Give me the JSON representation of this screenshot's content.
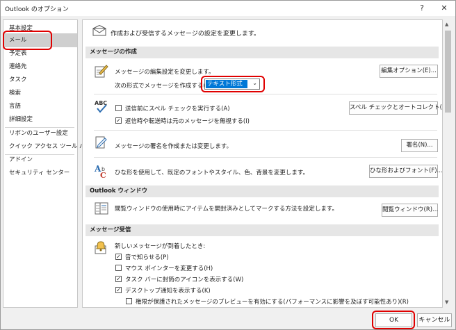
{
  "window": {
    "title": "Outlook のオプション",
    "help_label": "?",
    "close_label": "✕"
  },
  "sidebar": {
    "items": [
      {
        "label": "基本設定"
      },
      {
        "label": "メール"
      },
      {
        "label": "予定表"
      },
      {
        "label": "連絡先"
      },
      {
        "label": "タスク"
      },
      {
        "label": "検索"
      },
      {
        "label": "言語"
      },
      {
        "label": "詳細設定"
      },
      {
        "label": "リボンのユーザー設定"
      },
      {
        "label": "クイック アクセス ツール バー"
      },
      {
        "label": "アドイン"
      },
      {
        "label": "セキュリティ センター"
      }
    ],
    "selected": "メール"
  },
  "main": {
    "intro": "作成および受信するメッセージの設定を変更します。",
    "compose": {
      "header": "メッセージの作成",
      "edit_settings_text": "メッセージの編集設定を変更します。",
      "edit_options_button": "編集オプション(E)...",
      "format_label": "次の形式でメッセージを作成する(C):",
      "format_value": "テキスト形式",
      "spell_check_before_send": {
        "label": "送信前にスペル チェックを実行する(A)",
        "checked": false
      },
      "ignore_original_text": {
        "label": "返信時や転送時は元のメッセージを無視する(I)",
        "checked": true
      },
      "spell_button": "スペル チェックとオートコレクト(S)...",
      "signature_text": "メッセージの署名を作成または変更します。",
      "signature_button": "署名(N)...",
      "stationery_text": "ひな形を使用して、既定のフォントやスタイル、色、背景を変更します。",
      "stationery_button": "ひな形およびフォント(F)..."
    },
    "reading_pane": {
      "header": "Outlook ウィンドウ",
      "text": "閲覧ウィンドウの使用時にアイテムを開封済みとしてマークする方法を設定します。",
      "button": "閲覧ウィンドウ(R)..."
    },
    "arrival": {
      "header": "メッセージ受信",
      "text": "新しいメッセージが到着したとき:",
      "options": [
        {
          "label": "音で知らせる(P)",
          "checked": true
        },
        {
          "label": "マウス ポインターを変更する(H)",
          "checked": false
        },
        {
          "label": "タスク バーに封筒のアイコンを表示する(W)",
          "checked": true
        },
        {
          "label": "デスクトップ通知を表示する(K)",
          "checked": true
        },
        {
          "label": "権限が保護されたメッセージのプレビューを有効にする(パフォーマンスに影響を及ぼす可能性あり)(R)",
          "checked": false
        }
      ]
    }
  },
  "footer": {
    "ok_label": "OK",
    "cancel_label": "キャンセル"
  },
  "colors": {
    "highlight": "#e00000",
    "selection": "#0078d7",
    "sidebar_selected": "#cfcfcf",
    "section_header": "#e6e6e6"
  },
  "icons": {
    "intro": "envelope-icon",
    "edit": "pen-paper-icon",
    "spell": "abc-spellcheck-icon",
    "signature": "signature-icon",
    "stationery": "stationery-font-icon",
    "reading_pane": "reading-pane-icon",
    "arrival": "bell-icon"
  }
}
